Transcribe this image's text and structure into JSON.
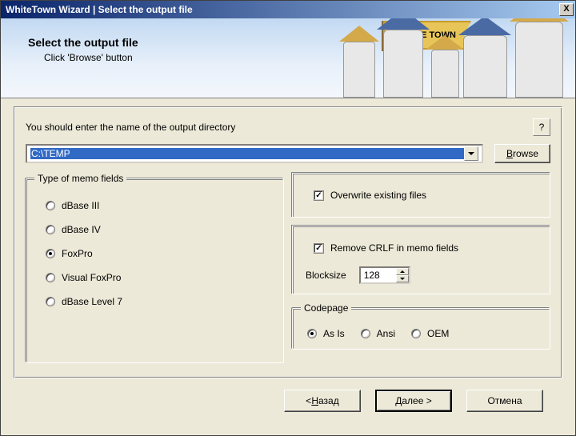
{
  "titlebar": {
    "text": "WhiteTown Wizard | Select the output file",
    "close": "X"
  },
  "banner": {
    "title": "Select the output file",
    "subtitle": "Click 'Browse' button",
    "flag": "WHITE TOWN"
  },
  "prompt": "You should enter the name of the output directory",
  "help": "?",
  "path": {
    "value": "C:\\TEMP"
  },
  "browse_label": "Browse",
  "memo_group": {
    "legend": "Type of memo fields",
    "options": [
      {
        "label": "dBase III",
        "checked": false
      },
      {
        "label": "dBase IV",
        "checked": false
      },
      {
        "label": "FoxPro",
        "checked": true
      },
      {
        "label": "Visual FoxPro",
        "checked": false
      },
      {
        "label": "dBase Level 7",
        "checked": false
      }
    ]
  },
  "overwrite": {
    "label": "Overwrite existing files",
    "checked": true
  },
  "remove_crlf": {
    "label": "Remove CRLF in memo fields",
    "checked": true
  },
  "blocksize": {
    "label": "Blocksize",
    "value": "128"
  },
  "codepage": {
    "legend": "Codepage",
    "options": [
      {
        "label": "As Is",
        "checked": true
      },
      {
        "label": "Ansi",
        "checked": false
      },
      {
        "label": "OEM",
        "checked": false
      }
    ]
  },
  "footer": {
    "back_pre": "< ",
    "back_u": "Н",
    "back_post": "азад",
    "next_pre": "",
    "next_u": "Д",
    "next_post": "алее >",
    "cancel": "Отмена"
  }
}
